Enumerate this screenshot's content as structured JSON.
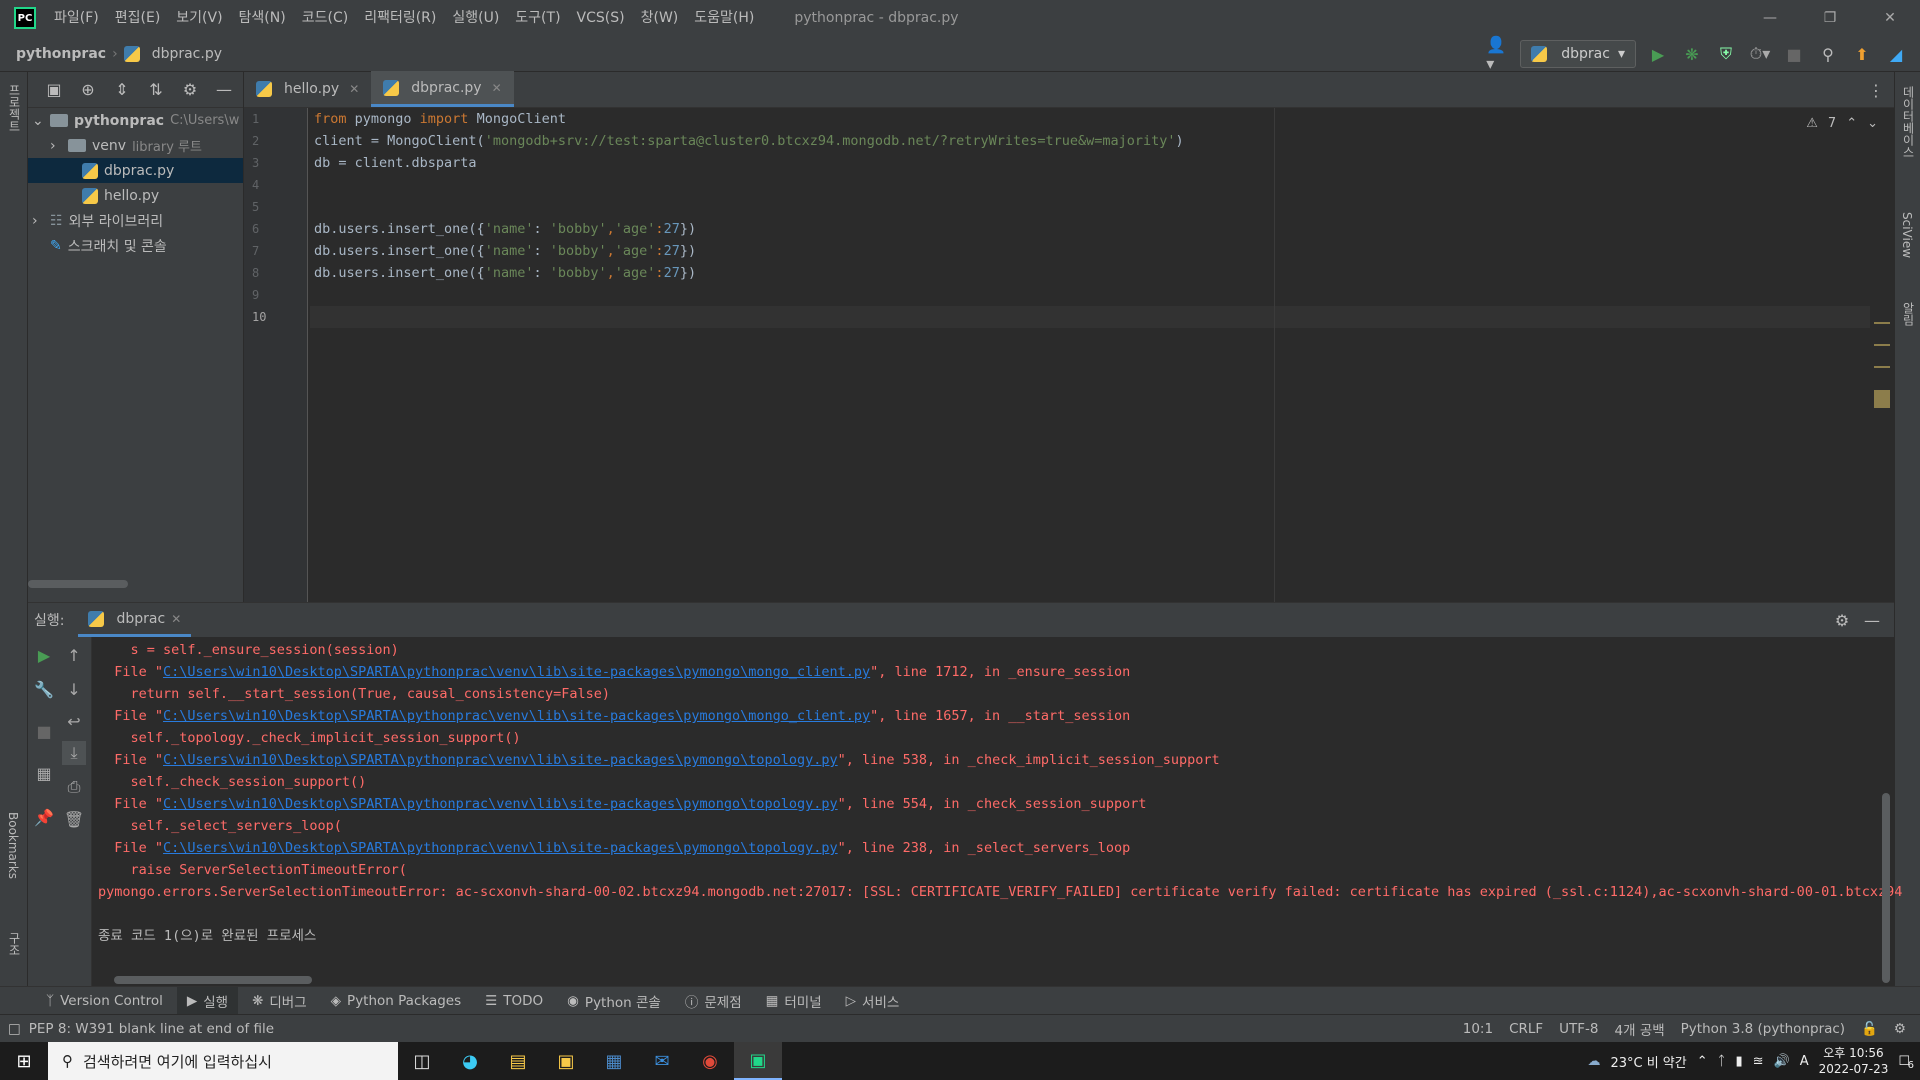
{
  "menu": [
    "파일(F)",
    "편집(E)",
    "보기(V)",
    "탐색(N)",
    "코드(C)",
    "리팩터링(R)",
    "실행(U)",
    "도구(T)",
    "VCS(S)",
    "창(W)",
    "도움말(H)"
  ],
  "window_title": "pythonprac - dbprac.py",
  "breadcrumb": {
    "project": "pythonprac",
    "file": "dbprac.py"
  },
  "run_config": "dbprac",
  "left_strip": {
    "project_label": "프로젝트",
    "bookmarks_label": "Bookmarks",
    "structure_label": "구조"
  },
  "right_strip": {
    "database_label": "데이터베이스",
    "sciview_label": "SciView",
    "notifications_label": "알림"
  },
  "project_tree": {
    "root": {
      "name": "pythonprac",
      "path": "C:\\Users\\w"
    },
    "venv": {
      "name": "venv",
      "note": "library 루트"
    },
    "files": [
      "dbprac.py",
      "hello.py"
    ],
    "external": "외부 라이브러리",
    "scratches": "스크래치 및 콘솔"
  },
  "tabs": [
    {
      "label": "hello.py"
    },
    {
      "label": "dbprac.py"
    }
  ],
  "code": {
    "line1_kw1": "from",
    "line1_mod": " pymongo ",
    "line1_kw2": "import",
    "line1_rest": " MongoClient",
    "line2_a": "client = MongoClient(",
    "line2_str": "'mongodb+srv://test:sparta@cluster0.btcxz94.mongodb.net/?retryWrites=true&w=majority'",
    "line2_b": ")",
    "line3": "db = client.dbsparta",
    "insert_a": "db.users.insert_one({",
    "key_name": "'name'",
    "colon": ": ",
    "val_bobby": "'bobby'",
    "comma": ",",
    "key_age": "'age'",
    "colon2": ":",
    "age": "27",
    "insert_b": "})"
  },
  "line_numbers": [
    "1",
    "2",
    "3",
    "4",
    "5",
    "6",
    "7",
    "8",
    "9",
    "10"
  ],
  "warnings": {
    "count": "7"
  },
  "run_panel": {
    "label": "실행:",
    "tab": "dbprac",
    "lines": [
      {
        "text": "    s = self._ensure_session(session)"
      },
      {
        "pre": "  File \"",
        "link": "C:\\Users\\win10\\Desktop\\SPARTA\\pythonprac\\venv\\lib\\site-packages\\pymongo\\mongo_client.py",
        "post": "\", line 1712, in _ensure_session"
      },
      {
        "text": "    return self.__start_session(True, causal_consistency=False)"
      },
      {
        "pre": "  File \"",
        "link": "C:\\Users\\win10\\Desktop\\SPARTA\\pythonprac\\venv\\lib\\site-packages\\pymongo\\mongo_client.py",
        "post": "\", line 1657, in __start_session"
      },
      {
        "text": "    self._topology._check_implicit_session_support()"
      },
      {
        "pre": "  File \"",
        "link": "C:\\Users\\win10\\Desktop\\SPARTA\\pythonprac\\venv\\lib\\site-packages\\pymongo\\topology.py",
        "post": "\", line 538, in _check_implicit_session_support"
      },
      {
        "text": "    self._check_session_support()"
      },
      {
        "pre": "  File \"",
        "link": "C:\\Users\\win10\\Desktop\\SPARTA\\pythonprac\\venv\\lib\\site-packages\\pymongo\\topology.py",
        "post": "\", line 554, in _check_session_support"
      },
      {
        "text": "    self._select_servers_loop("
      },
      {
        "pre": "  File \"",
        "link": "C:\\Users\\win10\\Desktop\\SPARTA\\pythonprac\\venv\\lib\\site-packages\\pymongo\\topology.py",
        "post": "\", line 238, in _select_servers_loop"
      },
      {
        "text": "    raise ServerSelectionTimeoutError("
      },
      {
        "text": "pymongo.errors.ServerSelectionTimeoutError: ac-scxonvh-shard-00-02.btcxz94.mongodb.net:27017: [SSL: CERTIFICATE_VERIFY_FAILED] certificate verify failed: certificate has expired (_ssl.c:1124),ac-scxonvh-shard-00-01.btcxz94"
      }
    ],
    "exit_message": "종료 코드 1(으)로 완료된 프로세스"
  },
  "bottom_tools": [
    "Version Control",
    "실행",
    "디버그",
    "Python Packages",
    "TODO",
    "Python 콘솔",
    "문제점",
    "터미널",
    "서비스"
  ],
  "status": {
    "message": "PEP 8: W391 blank line at end of file",
    "position": "10:1",
    "line_sep": "CRLF",
    "encoding": "UTF-8",
    "indent": "4개 공백",
    "interpreter": "Python 3.8 (pythonprac)"
  },
  "taskbar": {
    "search_placeholder": "검색하려면 여기에 입력하십시",
    "weather": "23°C 비 약간",
    "ime": "A",
    "time": "오후 10:56",
    "date": "2022-07-23",
    "notif_count": "6"
  },
  "colors": {
    "accent": "#4a88c7",
    "error": "#ff6b68",
    "link": "#287bde"
  }
}
